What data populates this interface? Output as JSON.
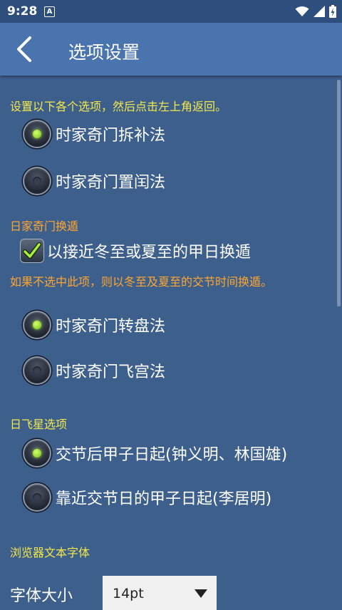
{
  "status_bar": {
    "time": "9:28",
    "notification_letter": "A",
    "icons": [
      "wifi-icon",
      "signal-icon",
      "battery-icon"
    ]
  },
  "app_bar": {
    "title": "选项设置",
    "back_icon": "chevron-left-icon"
  },
  "instructions": "设置以下各个选项，然后点击左上角返回。",
  "qimen_method": {
    "options": [
      {
        "label": "时家奇门拆补法",
        "selected": true
      },
      {
        "label": "时家奇门置闰法",
        "selected": false
      }
    ]
  },
  "day_qimen": {
    "heading": "日家奇门换遁",
    "checkbox_label": "以接近冬至或夏至的甲日换遁",
    "checked": true,
    "note": "如果不选中此项，则以冬至及夏至的交节时间换遁。"
  },
  "plate_method": {
    "options": [
      {
        "label": "时家奇门转盘法",
        "selected": true
      },
      {
        "label": "时家奇门飞宫法",
        "selected": false
      }
    ]
  },
  "day_star": {
    "heading": "日飞星选项",
    "options": [
      {
        "label": "交节后甲子日起(钟义明、林国雄)",
        "selected": true
      },
      {
        "label": "靠近交节日的甲子日起(李居明)",
        "selected": false
      }
    ]
  },
  "browser_font": {
    "heading": "浏览器文本字体",
    "size_label": "字体大小",
    "size_value": "14pt"
  },
  "colors": {
    "background": "#3d5f8c",
    "app_bar": "#4a74ad",
    "status_bar": "#2e4f7e",
    "yellow_text": "#f4e84a",
    "orange_text": "#ffa630",
    "radio_on": "#8fdc2a"
  }
}
